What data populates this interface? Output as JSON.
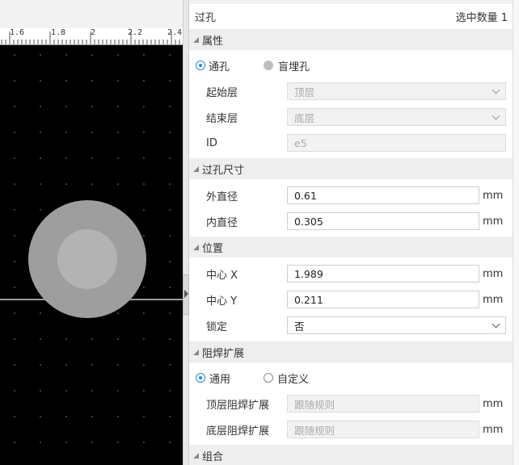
{
  "ruler": {
    "labels": [
      "1.6",
      "1.8",
      "2",
      "2.2",
      "2.4"
    ]
  },
  "panel": {
    "title": "过孔",
    "selected_count_label": "选中数量",
    "selected_count": "1"
  },
  "sections": {
    "attributes": {
      "title": "属性",
      "via_type": {
        "options": [
          "通孔",
          "盲埋孔"
        ],
        "selected": "通孔"
      },
      "start_layer": {
        "label": "起始层",
        "value": "顶层"
      },
      "end_layer": {
        "label": "结束层",
        "value": "底层"
      },
      "id": {
        "label": "ID",
        "value": "e5"
      }
    },
    "via_size": {
      "title": "过孔尺寸",
      "outer_diameter": {
        "label": "外直径",
        "value": "0.61",
        "unit": "mm"
      },
      "inner_diameter": {
        "label": "内直径",
        "value": "0.305",
        "unit": "mm"
      }
    },
    "position": {
      "title": "位置",
      "center_x": {
        "label": "中心 X",
        "value": "1.989",
        "unit": "mm"
      },
      "center_y": {
        "label": "中心 Y",
        "value": "0.211",
        "unit": "mm"
      },
      "locked": {
        "label": "锁定",
        "value": "否"
      }
    },
    "solder_mask": {
      "title": "阻焊扩展",
      "mode": {
        "options": [
          "通用",
          "自定义"
        ],
        "selected": "通用"
      },
      "top": {
        "label": "顶层阻焊扩展",
        "value": "跟随规则",
        "unit": "mm"
      },
      "bottom": {
        "label": "底层阻焊扩展",
        "value": "跟随规则",
        "unit": "mm"
      }
    },
    "group": {
      "title": "组合"
    }
  },
  "colors": {
    "canvas_bg": "#000000",
    "via_outer": "#9e9e9e",
    "via_inner": "#b3b3b3",
    "accent": "#1e88e5"
  }
}
